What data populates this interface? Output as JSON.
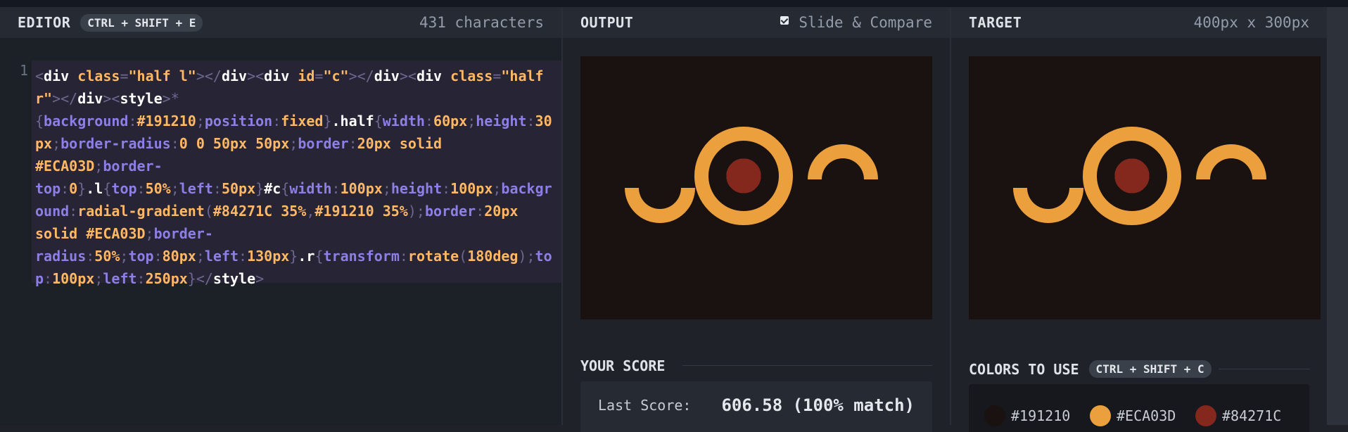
{
  "editor": {
    "title": "EDITOR",
    "shortcut": "CTRL + SHIFT + E",
    "char_count": "431 characters",
    "line_number": "1"
  },
  "output": {
    "title": "OUTPUT",
    "slide_compare_label": "Slide & Compare",
    "slide_compare_checked": true
  },
  "target": {
    "title": "TARGET",
    "dimensions": "400px x 300px"
  },
  "score": {
    "section_title": "YOUR SCORE",
    "last_score_label": "Last Score:",
    "last_score_value": "606.58 (100% match)"
  },
  "colors": {
    "section_title": "COLORS TO USE",
    "shortcut": "CTRL + SHIFT + C",
    "swatches": [
      {
        "hex": "#191210",
        "label": "#191210"
      },
      {
        "hex": "#ECA03D",
        "label": "#ECA03D"
      },
      {
        "hex": "#84271C",
        "label": "#84271C"
      }
    ]
  },
  "theme": {
    "canvas_bg": "#191210",
    "accent_orange": "#ECA03D",
    "accent_red": "#84271C"
  }
}
